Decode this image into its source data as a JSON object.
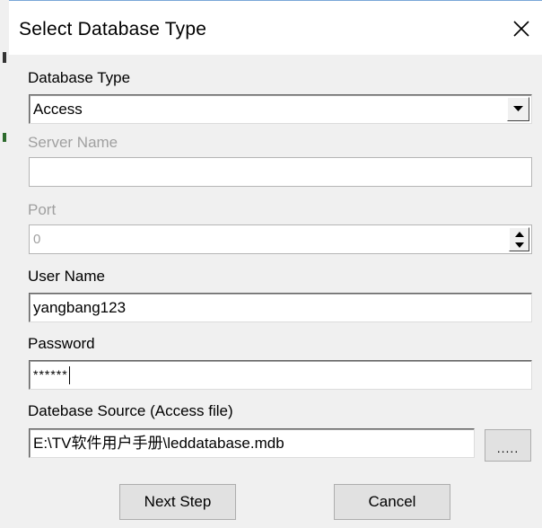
{
  "window": {
    "title": "Select Database Type",
    "close_icon": "close-icon"
  },
  "form": {
    "db_type": {
      "label": "Database Type",
      "value": "Access"
    },
    "server_name": {
      "label": "Server Name",
      "value": ""
    },
    "port": {
      "label": "Port",
      "value": "0"
    },
    "user_name": {
      "label": "User Name",
      "value": "yangbang123"
    },
    "password": {
      "label": "Password",
      "value": "******"
    },
    "source": {
      "label": "Datebase Source (Access file)",
      "value": "E:\\TV软件用户手册\\leddatabase.mdb",
      "browse_label": "....."
    }
  },
  "buttons": {
    "next_label": "Next Step",
    "cancel_label": "Cancel"
  }
}
